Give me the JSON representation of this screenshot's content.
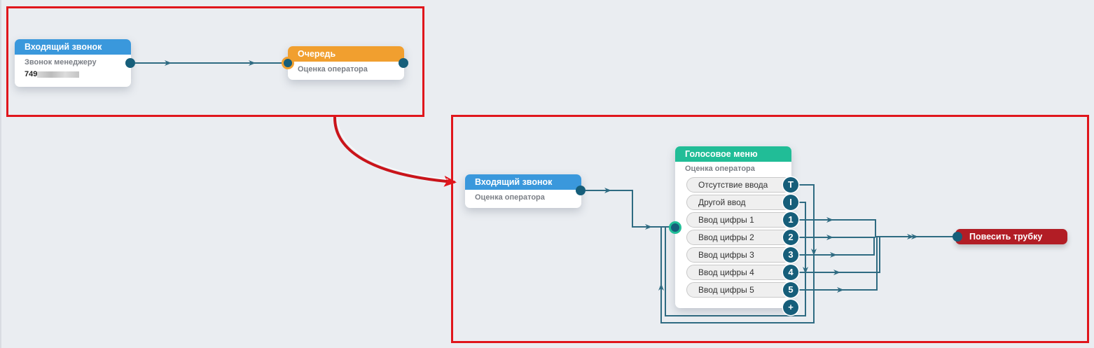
{
  "top_flow": {
    "incoming": {
      "title": "Входящий звонок",
      "subtitle": "Звонок менеджеру",
      "number_visible": "749"
    },
    "queue": {
      "title": "Очередь",
      "subtitle": "Оценка оператора"
    }
  },
  "bottom_flow": {
    "incoming": {
      "title": "Входящий звонок",
      "subtitle": "Оценка оператора"
    },
    "voice_menu": {
      "title": "Голосовое меню",
      "subtitle": "Оценка оператора",
      "items": [
        {
          "label": "Отсутствие ввода",
          "badge": "T"
        },
        {
          "label": "Другой ввод",
          "badge": "I"
        },
        {
          "label": "Ввод цифры 1",
          "badge": "1"
        },
        {
          "label": "Ввод цифры 2",
          "badge": "2"
        },
        {
          "label": "Ввод цифры 3",
          "badge": "3"
        },
        {
          "label": "Ввод цифры 4",
          "badge": "4"
        },
        {
          "label": "Ввод цифры 5",
          "badge": "5"
        }
      ],
      "add_badge": "+"
    },
    "hangup": {
      "title": "Повесить трубку"
    }
  },
  "colors": {
    "highlight_frame": "#e0161c",
    "wire": "#2f6b82",
    "port": "#165e7a",
    "header_blue": "#3a98dc",
    "header_orange": "#f19f2f",
    "header_green": "#21bd97",
    "hangup_red": "#b21d25"
  }
}
